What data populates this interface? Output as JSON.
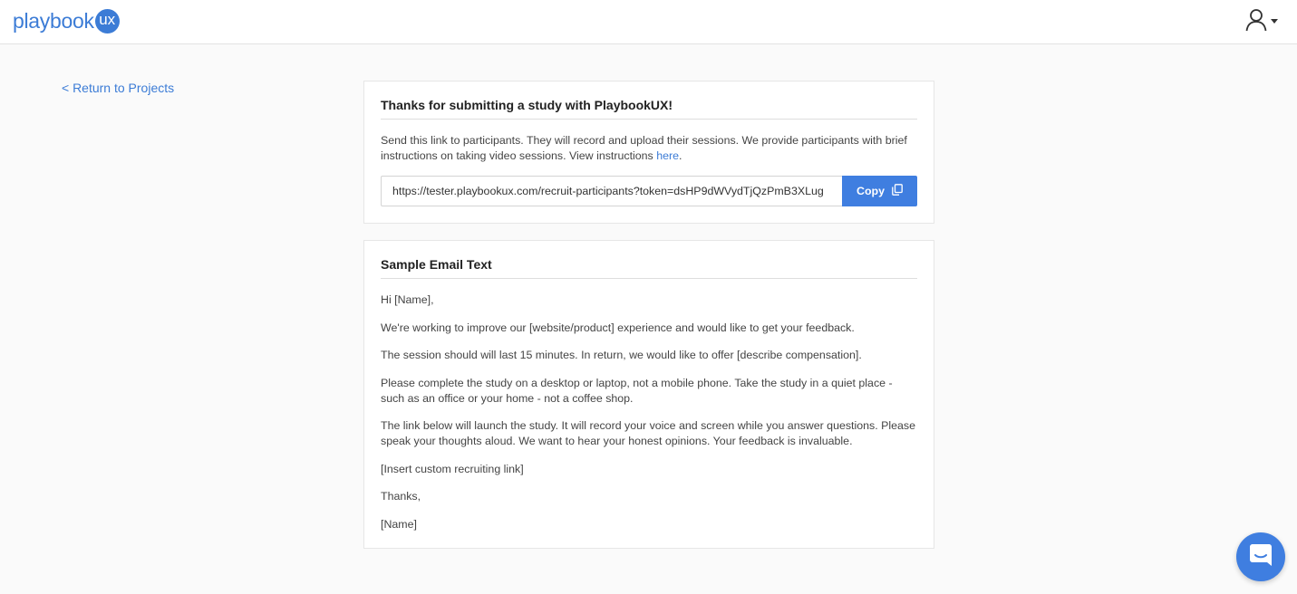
{
  "header": {
    "logo_text": "playbook",
    "logo_badge": "ux"
  },
  "nav": {
    "return_link": "< Return to Projects"
  },
  "submit_card": {
    "title": "Thanks for submitting a study with PlaybookUX!",
    "description": "Send this link to participants. They will record and upload their sessions. We provide participants with brief instructions on taking video sessions. View instructions ",
    "here_link": "here",
    "description_end": ".",
    "link_value": "https://tester.playbookux.com/recruit-participants?token=dsHP9dWVydTjQzPmB3XLug",
    "copy_label": "Copy"
  },
  "email_card": {
    "title": "Sample Email Text",
    "paragraphs": [
      "Hi [Name],",
      "We're working to improve our [website/product] experience and would like to get your feedback.",
      "The session should will last 15 minutes. In return, we would like to offer [describe compensation].",
      "Please complete the study on a desktop or laptop, not a mobile phone. Take the study in a quiet place - such as an office or your home - not a coffee shop.",
      "The link below will launch the study. It will record your voice and screen while you answer questions. Please speak your thoughts aloud. We want to hear your honest opinions. Your feedback is invaluable.",
      "[Insert custom recruiting link]",
      "Thanks,",
      "[Name]"
    ]
  },
  "icons": {
    "user": "user-icon",
    "copy": "copy-icon",
    "chat": "chat-icon"
  },
  "colors": {
    "accent": "#3c7cd6",
    "button": "#3f7ee0",
    "background": "#fafafa"
  }
}
